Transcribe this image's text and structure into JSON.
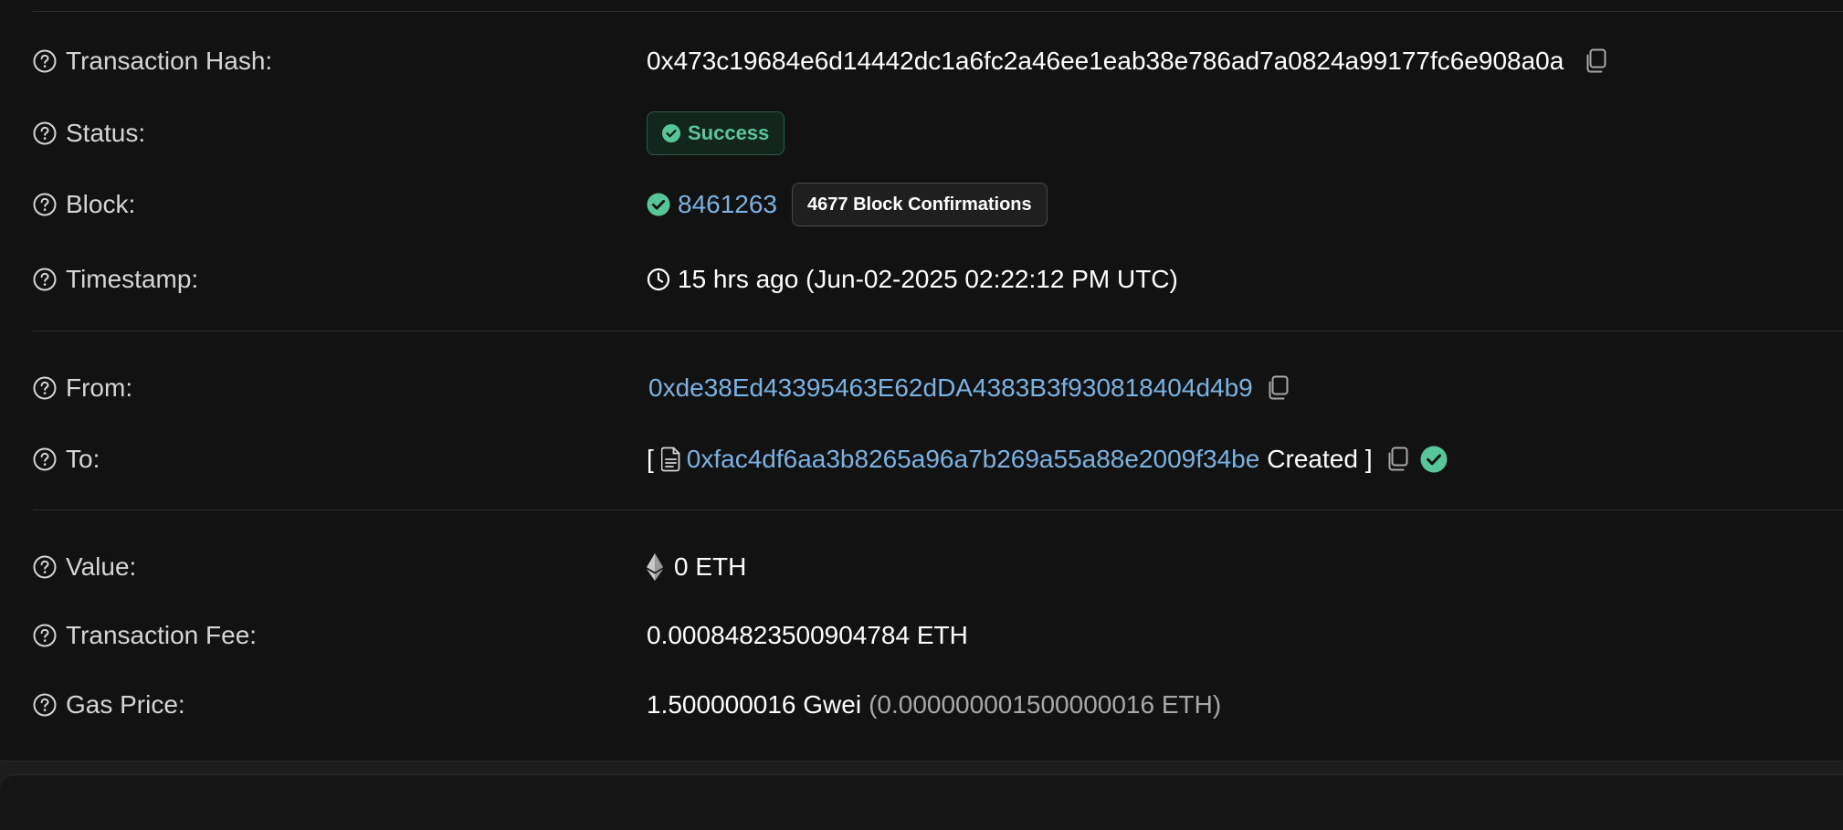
{
  "rows": {
    "hash": {
      "label": "Transaction Hash:",
      "value": "0x473c19684e6d14442dc1a6fc2a46ee1eab38e786ad7a0824a99177fc6e908a0a"
    },
    "status": {
      "label": "Status:",
      "value": "Success"
    },
    "block": {
      "label": "Block:",
      "number": "8461263",
      "confirmations": "4677 Block Confirmations"
    },
    "timestamp": {
      "label": "Timestamp:",
      "value": "15 hrs ago (Jun-02-2025 02:22:12 PM UTC)"
    },
    "from": {
      "label": "From:",
      "address": "0xde38Ed43395463E62dDA4383B3f930818404d4b9"
    },
    "to": {
      "label": "To:",
      "open_bracket": "[",
      "address": "0xfac4df6aa3b8265a96a7b269a55a88e2009f34be",
      "created": "Created",
      "close_bracket": "]"
    },
    "value": {
      "label": "Value:",
      "amount": "0 ETH"
    },
    "fee": {
      "label": "Transaction Fee:",
      "amount": "0.00084823500904784 ETH"
    },
    "gas": {
      "label": "Gas Price:",
      "gwei": "1.500000016 Gwei",
      "eth": "(0.000000001500000016 ETH)"
    }
  },
  "icons": {
    "help": "question-circle-icon",
    "copy": "copy-icon",
    "success": "check-circle-icon",
    "clock": "clock-icon",
    "contract": "file-document-icon",
    "ethereum": "ethereum-icon"
  },
  "colors": {
    "background": "#121212",
    "link": "#78b3e3",
    "success": "#57c79a",
    "label": "#d5d5d5"
  }
}
